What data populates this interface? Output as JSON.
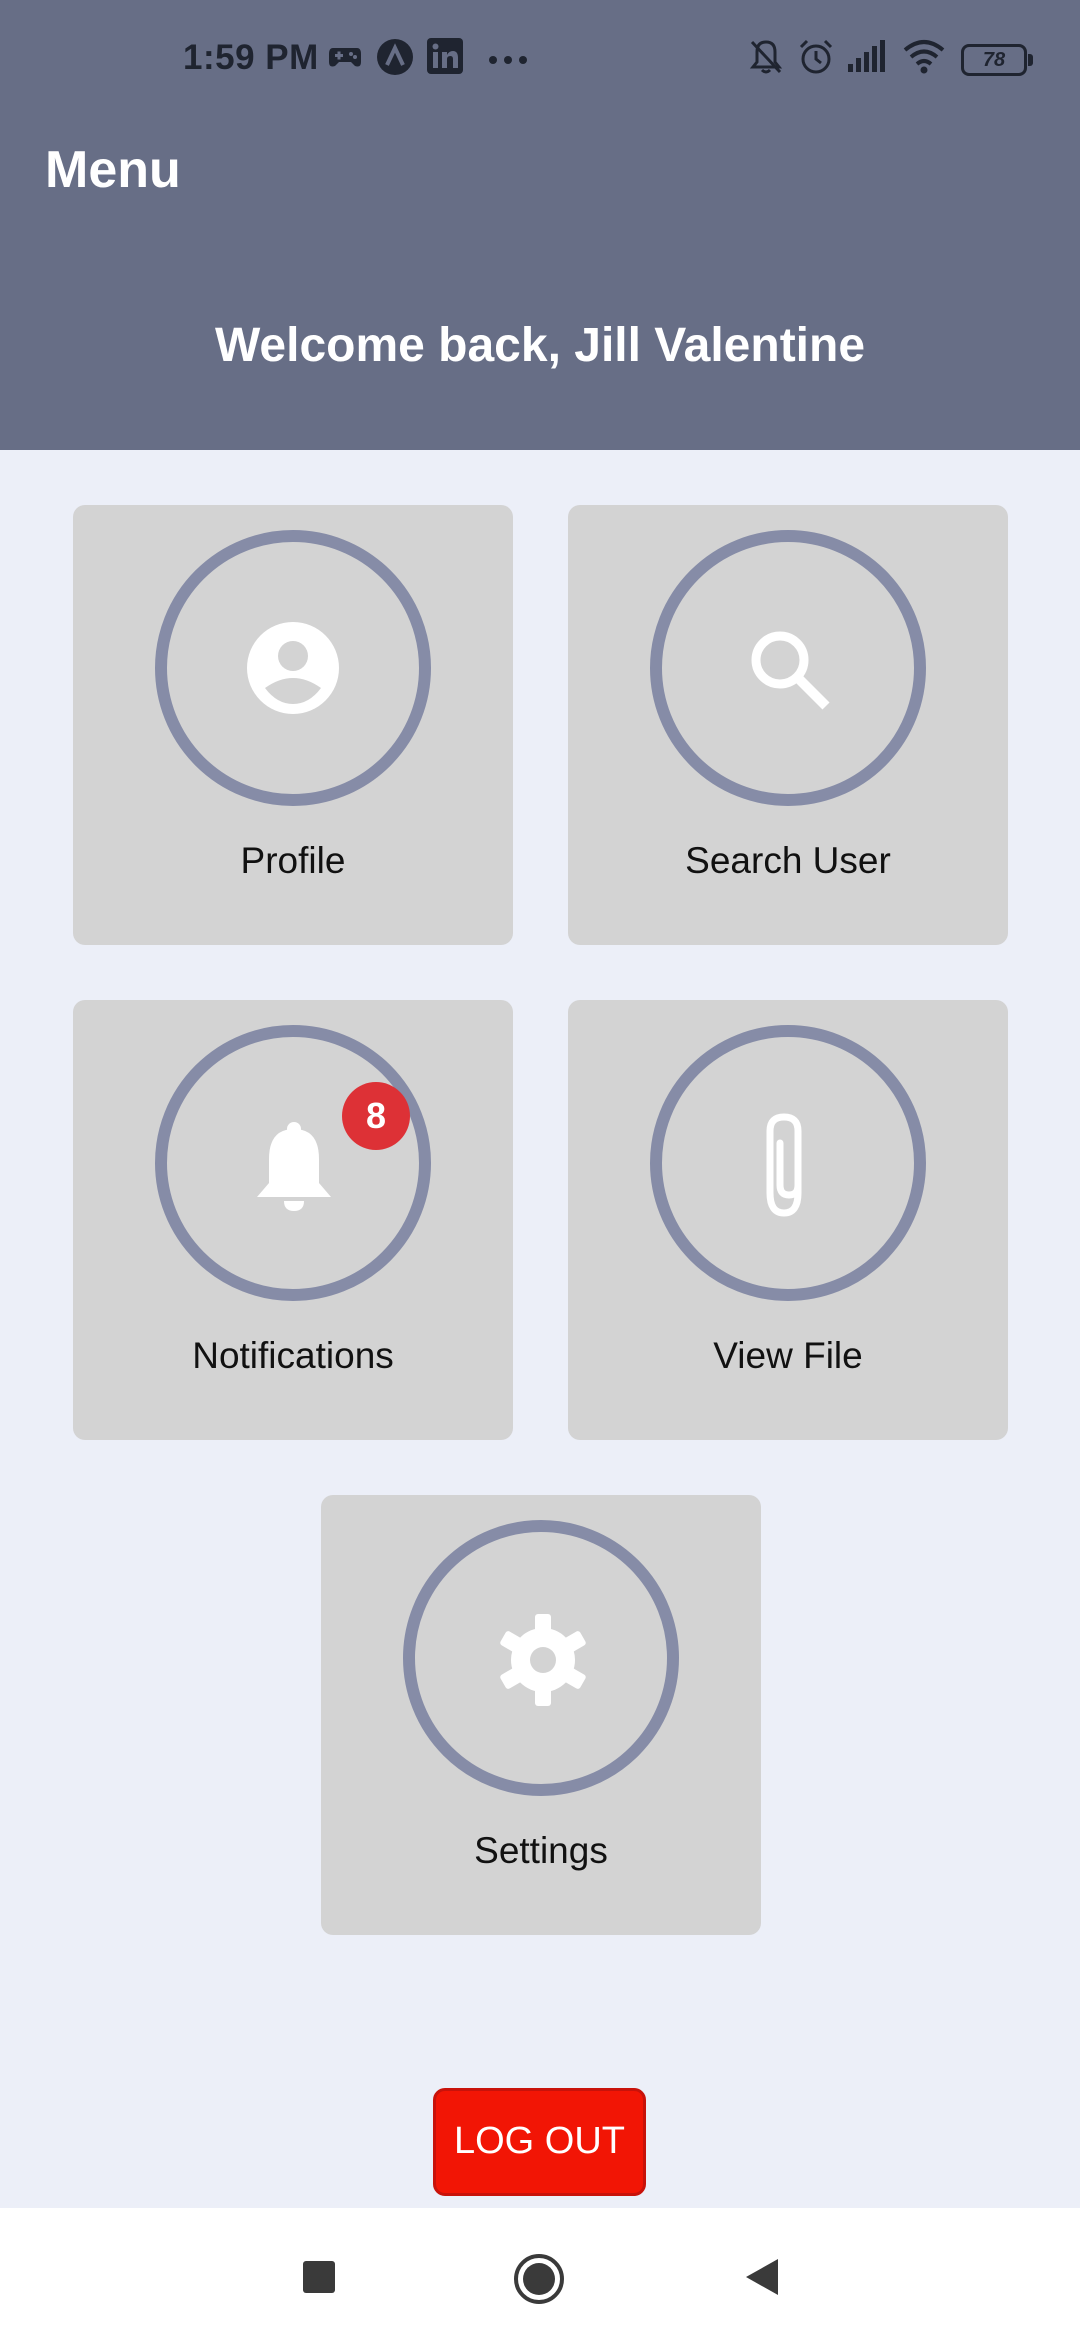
{
  "status_bar": {
    "time": "1:59 PM",
    "left_icons": [
      "game-controller-icon",
      "arc-app-icon",
      "linkedin-icon",
      "more-dots-icon"
    ],
    "right_icons": [
      "bell-muted-icon",
      "alarm-icon",
      "signal-icon",
      "wifi-icon"
    ],
    "battery": "78"
  },
  "header": {
    "title": "Menu",
    "welcome": "Welcome back, Jill Valentine",
    "background": "#676e86"
  },
  "tiles": [
    {
      "label": "Profile",
      "icon": "account-circle-icon"
    },
    {
      "label": "Search User",
      "icon": "search-icon"
    },
    {
      "label": "Notifications",
      "icon": "bell-icon",
      "badge": "8"
    },
    {
      "label": "View File",
      "icon": "paperclip-icon"
    },
    {
      "label": "Settings",
      "icon": "gear-icon"
    }
  ],
  "logout": {
    "label": "LOG OUT",
    "color": "#f21505"
  },
  "nav_bar": {
    "buttons": [
      "recents-square-icon",
      "home-circle-icon",
      "back-triangle-icon"
    ]
  },
  "colors": {
    "ring": "#868ca7",
    "tile": "#d3d3d3",
    "badge": "#dd3136",
    "page": "#eceff8"
  }
}
